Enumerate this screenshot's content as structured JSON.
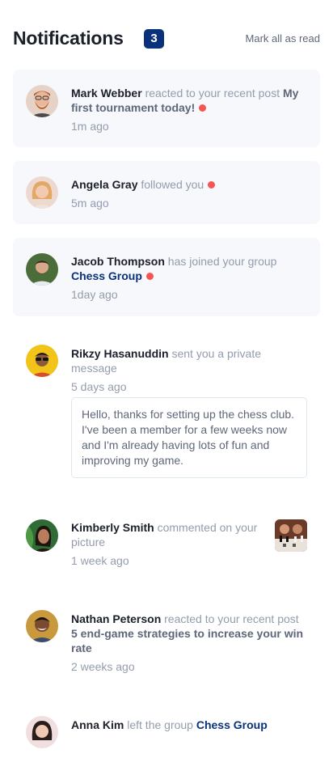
{
  "header": {
    "title": "Notifications",
    "count": "3",
    "mark_all_label": "Mark all as read"
  },
  "notifications": [
    {
      "name": "Mark Webber",
      "action": "reacted to your recent post",
      "post": "My first tournament today!",
      "time": "1m ago",
      "unread": true
    },
    {
      "name": "Angela Gray",
      "action": "followed you",
      "time": "5m ago",
      "unread": true
    },
    {
      "name": "Jacob Thompson",
      "action": "has joined your group",
      "group": "Chess Group",
      "time": "1day ago",
      "unread": true
    },
    {
      "name": "Rikzy Hasanuddin",
      "action": "sent you a private message",
      "time": "5 days ago",
      "message": "Hello, thanks for setting up the chess club. I've been a member for a few weeks now and I'm already having lots of fun and improving my game.",
      "unread": false
    },
    {
      "name": "Kimberly Smith",
      "action": "commented on your picture",
      "time": "1 week ago",
      "unread": false
    },
    {
      "name": "Nathan Peterson",
      "action": "reacted to your recent post",
      "post": "5 end-game strategies to increase your win rate",
      "time": "2 weeks ago",
      "unread": false
    },
    {
      "name": "Anna Kim",
      "action": "left the group",
      "group": "Chess Group",
      "unread": false
    }
  ],
  "colors": {
    "blue": "#0a327b",
    "red_dot": "#f65552",
    "unread_bg": "#f6f8fb",
    "dark_text": "#1c202b",
    "grey_text": "#939cad"
  },
  "icons": [
    "avatar-mark-webber",
    "avatar-angela-gray",
    "avatar-jacob-thompson",
    "avatar-rikzy-hasanuddin",
    "avatar-kimberly-smith",
    "avatar-nathan-peterson",
    "avatar-anna-kim",
    "chess-picture-thumbnail"
  ]
}
